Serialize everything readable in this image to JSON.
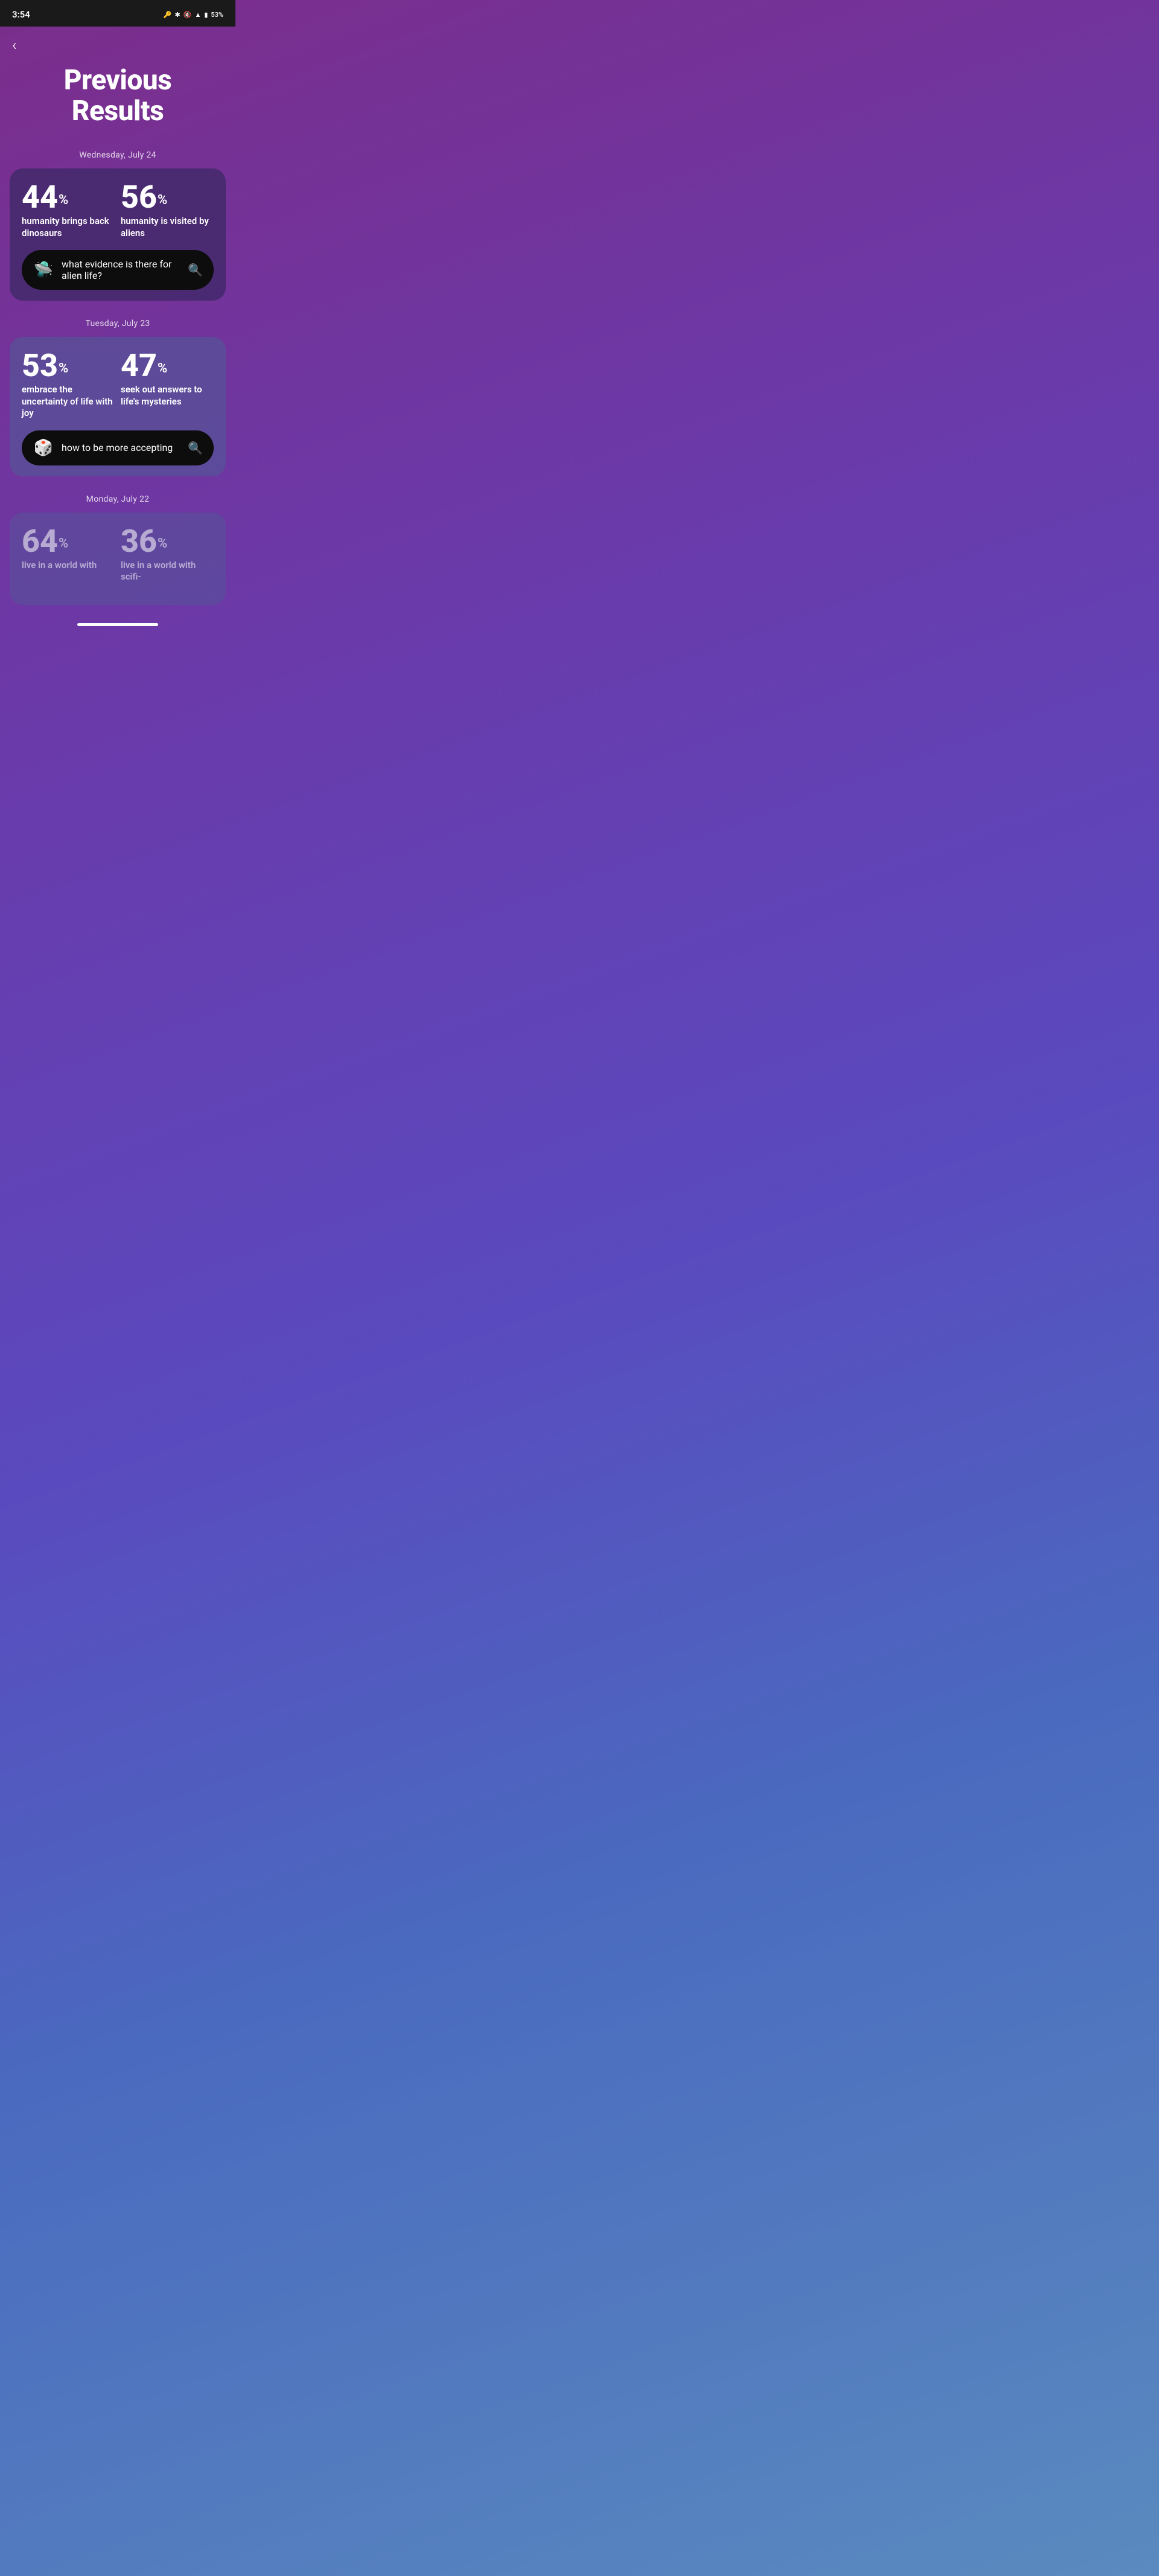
{
  "statusBar": {
    "time": "3:54",
    "battery": "53%",
    "icons": "⊞ ❋ 🔇 ▲ ▮ 🔋"
  },
  "page": {
    "backLabel": "‹",
    "title": "Previous Results"
  },
  "sections": [
    {
      "date": "Wednesday, July 24",
      "card": {
        "stat1": {
          "number": "44",
          "percent": "%",
          "label": "humanity brings back dinosaurs",
          "dim": false
        },
        "stat2": {
          "number": "56",
          "percent": "%",
          "label": "humanity is visited by aliens",
          "dim": false
        },
        "searchIcon": "🛸",
        "searchText": "what evidence is there for alien life?"
      }
    },
    {
      "date": "Tuesday, July 23",
      "card": {
        "stat1": {
          "number": "53",
          "percent": "%",
          "label": "embrace the uncertainty of life with joy",
          "dim": false
        },
        "stat2": {
          "number": "47",
          "percent": "%",
          "label": "seek out answers to life's mysteries",
          "dim": false
        },
        "searchIcon": "🎲",
        "searchText": "how to be more accepting"
      }
    },
    {
      "date": "Monday, July 22",
      "card": {
        "stat1": {
          "number": "64",
          "percent": "%",
          "label": "live in a world with",
          "dim": true
        },
        "stat2": {
          "number": "36",
          "percent": "%",
          "label": "live in a world with scifi-",
          "dim": true
        },
        "searchIcon": "",
        "searchText": ""
      }
    }
  ]
}
